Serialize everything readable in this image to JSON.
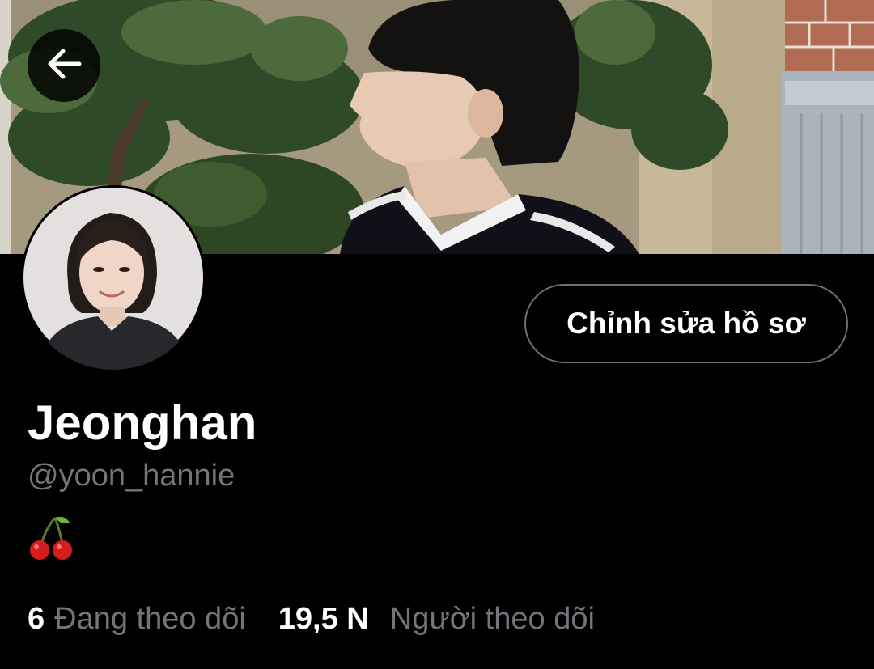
{
  "header": {
    "back_icon": "arrow-left-icon"
  },
  "profile": {
    "edit_button_label": "Chỉnh sửa hồ sơ",
    "display_name": "Jeonghan",
    "handle": "@yoon_hannie",
    "bio_icon": "cherries-emoji"
  },
  "stats": {
    "following_count": "6",
    "following_label": "Đang theo dõi",
    "followers_count": "19,5 N",
    "followers_label": "Người theo dõi"
  },
  "colors": {
    "background": "#000000",
    "text_primary": "#ffffff",
    "text_secondary": "#71767b",
    "button_border": "#6b7177"
  }
}
